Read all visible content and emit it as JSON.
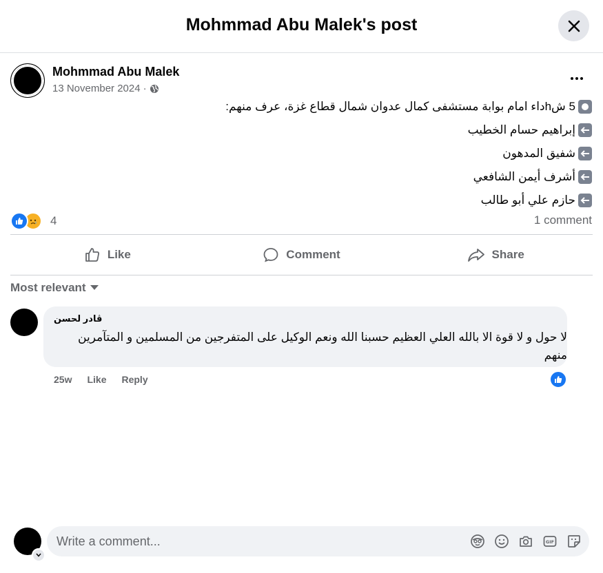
{
  "header": {
    "title": "Mohmmad Abu Malek's post"
  },
  "post": {
    "author": "Mohmmad Abu Malek",
    "date": "13 November 2024",
    "separator": "·",
    "lines": [
      "5 شhداء  امام بوابة مستشفى كمال عدوان شمال قطاع غزة، عرف منهم:",
      "إبراهيم حسام الخطيب",
      "شفيق المدهون",
      "أشرف أيمن الشافعي",
      "حازم علي أبو طالب"
    ],
    "reaction_count": "4",
    "comment_count": "1 comment"
  },
  "actions": {
    "like": "Like",
    "comment": "Comment",
    "share": "Share"
  },
  "sort": {
    "label": "Most relevant"
  },
  "comment": {
    "author": "ڤادر لحسن",
    "text": "لا حول و لا قوة الا بالله العلي العظيم حسبنا الله ونعم الوكيل على المتفرجين من المسلمين و المتآمرين منهم",
    "time": "25w",
    "like": "Like",
    "reply": "Reply"
  },
  "composer": {
    "placeholder": "Write a comment..."
  },
  "icons": [
    "close-icon",
    "globe-icon",
    "more-icon",
    "like-icon",
    "comment-icon",
    "share-icon",
    "chevron-down-icon",
    "avatar-sticker-icon",
    "emoji-icon",
    "camera-icon",
    "gif-icon",
    "sticker-icon"
  ],
  "colors": {
    "accent": "#1877f2",
    "muted": "#65676b",
    "bubble": "#f0f2f5"
  }
}
